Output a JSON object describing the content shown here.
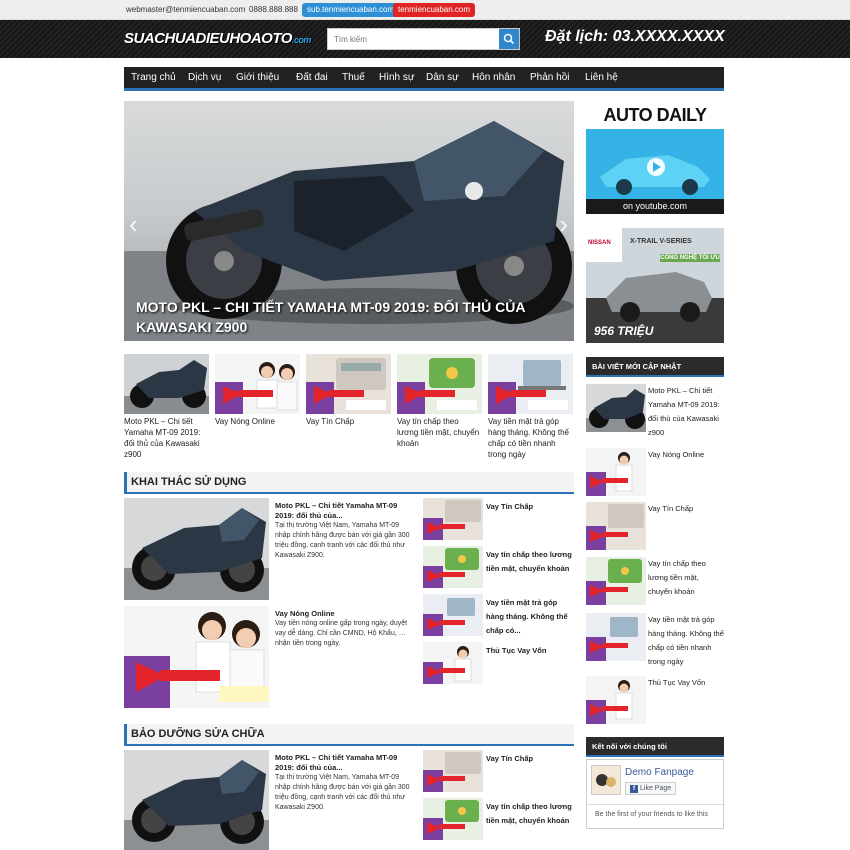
{
  "topbar": {
    "email": "webmaster@tenmiencuaban.com",
    "phone": "0888.888.888",
    "sub_domain": "sub.tenmiencuaban.com",
    "domain": "tenmiencuaban.com"
  },
  "header": {
    "logo_main": "SUACHUADIEUHOAOTO",
    "logo_ext": ".com",
    "search_placeholder": "Tìm kiếm",
    "hotline": "Đặt lịch: 03.XXXX.XXXX"
  },
  "nav": [
    "Trang chủ",
    "Dịch vụ",
    "Giới thiệu",
    "Đất đai",
    "Thuế",
    "Hình sự",
    "Dân sự",
    "Hôn nhân",
    "Phản hồi",
    "Liên hệ"
  ],
  "slider": {
    "caption": "MOTO PKL – CHI TIẾT YAMAHA MT-09 2019: ĐỐI THỦ CỦA KAWASAKI Z900",
    "prev": "‹",
    "next": "›"
  },
  "thumbs": [
    {
      "caption": "Moto PKL – Chi tiết Yamaha MT-09 2019: đối thủ của Kawasaki z900",
      "type": "moto"
    },
    {
      "caption": "Vay Nóng Online",
      "type": "people"
    },
    {
      "caption": "Vay Tín Chấp",
      "type": "calc"
    },
    {
      "caption": "Vay tín chấp theo lương tiền mặt, chuyển khoản",
      "type": "green"
    },
    {
      "caption": "Vay tiền mặt trả góp hàng tháng. Không thế chấp có tiền nhanh trong ngày",
      "type": "laptop"
    }
  ],
  "section1": {
    "title": "KHAI THÁC SỬ DỤNG",
    "big": [
      {
        "title": "Moto PKL – Chi tiết Yamaha MT-09 2019: đối thủ của...",
        "excerpt": "Tại thị trường Việt Nam, Yamaha MT-09 nhập chính hãng được bán với giá gần 300 triệu đồng, cạnh tranh với các đối thủ như Kawasaki Z900."
      },
      {
        "title": "Vay Nóng Online",
        "excerpt": "Vay tiền nóng online gấp trong ngày, duyệt vay dễ dàng. Chỉ cần CMND, Hộ Khẩu, … nhận tiền trong ngày."
      }
    ],
    "small": [
      "Vay Tín Chấp",
      "Vay tín chấp theo lương tiền mặt, chuyển khoản",
      "Vay tiền mặt trả góp hàng tháng. Không thế chấp có...",
      "Thủ Tục Vay Vốn"
    ]
  },
  "section2": {
    "title": "BẢO DƯỠNG SỬA CHỮA",
    "big": [
      {
        "title": "Moto PKL – Chi tiết Yamaha MT-09 2019: đối thủ của...",
        "excerpt": "Tại thị trường Việt Nam, Yamaha MT-09 nhập chính hãng được bán với giá gần 300 triệu đồng, cạnh tranh với các đối thủ như Kawasaki Z900."
      }
    ],
    "small": [
      "Vay Tín Chấp",
      "Vay tín chấp theo lương tiền mặt, chuyển khoản"
    ]
  },
  "ads": {
    "autodaily": "AUTO DAILY",
    "youtube": "on youtube.com",
    "nissan_model": "X-TRAIL V-SERIES",
    "nissan_brand": "NISSAN",
    "nissan_tag": "CÔNG NGHỆ TỐI ƯU",
    "nissan_price": "956 TRIỆU"
  },
  "sidebar": {
    "latest_title": "BÀI VIẾT MỚI CẬP NHẬT",
    "latest": [
      "Moto PKL – Chi tiết Yamaha MT-09 2019: đối thủ của Kawasaki z900",
      "Vay Nóng Online",
      "Vay Tín Chấp",
      "Vay tín chấp theo lương tiền mặt, chuyển khoản",
      "Vay tiền mặt trả góp hàng tháng. Không thế chấp có tiền nhanh trong ngày",
      "Thủ Tục Vay Vốn"
    ],
    "connect_title": "Kết nối với chúng tôi",
    "fanpage": "Demo Fanpage",
    "like": "Like Page",
    "friends": "Be the first of your friends to like this"
  },
  "colors": {
    "accent": "#2c72b8",
    "dark": "#222222",
    "sub_pill": "#2d8fd5",
    "domain_pill": "#e02424"
  }
}
